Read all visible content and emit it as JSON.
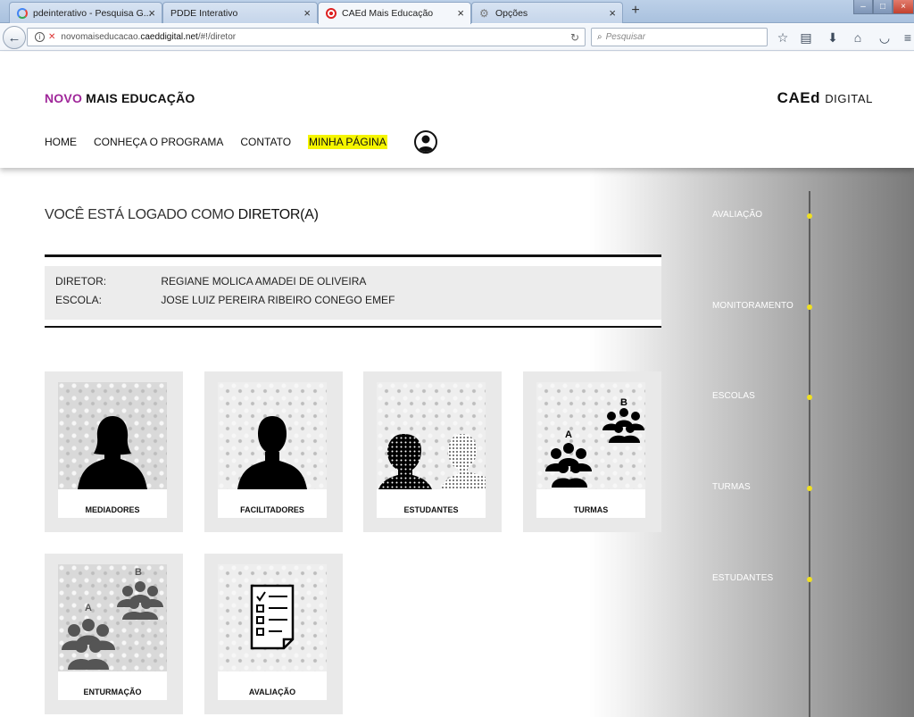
{
  "browser": {
    "tabs": [
      {
        "title": "pdeinterativo - Pesquisa G..."
      },
      {
        "title": "PDDE Interativo"
      },
      {
        "title": "CAEd Mais Educação"
      },
      {
        "title": "Opções"
      }
    ],
    "url_prefix": "novomaiseducacao.",
    "url_domain": "caeddigital.net",
    "url_suffix": "/#!/diretor",
    "search_placeholder": "Pesquisar"
  },
  "header": {
    "brand_novo": "NOVO",
    "brand_rest": "MAIS EDUCAÇÃO",
    "caed_bold": "CAEd",
    "caed_light": "DIGITAL",
    "menu": [
      "HOME",
      "CONHEÇA O PROGRAMA",
      "CONTATO",
      "MINHA PÁGINA"
    ]
  },
  "main": {
    "logged_prefix": "VOCÊ ESTÁ LOGADO COMO",
    "logged_role": "DIRETOR(A)",
    "director_label": "DIRETOR:",
    "director_value": "REGIANE MOLICA AMADEI DE OLIVEIRA",
    "school_label": "ESCOLA:",
    "school_value": "JOSE LUIZ PEREIRA RIBEIRO CONEGO EMEF",
    "cards": [
      "MEDIADORES",
      "FACILITADORES",
      "ESTUDANTES",
      "TURMAS",
      "ENTURMAÇÃO",
      "AVALIAÇÃO"
    ]
  },
  "timeline": [
    "AVALIAÇÃO",
    "MONITORAMENTO",
    "ESCOLAS",
    "TURMAS",
    "ESTUDANTES"
  ],
  "colors": {
    "brand_purple": "#a0279a",
    "highlight_yellow": "#f5f500",
    "timeline_dot": "#f0e020"
  }
}
